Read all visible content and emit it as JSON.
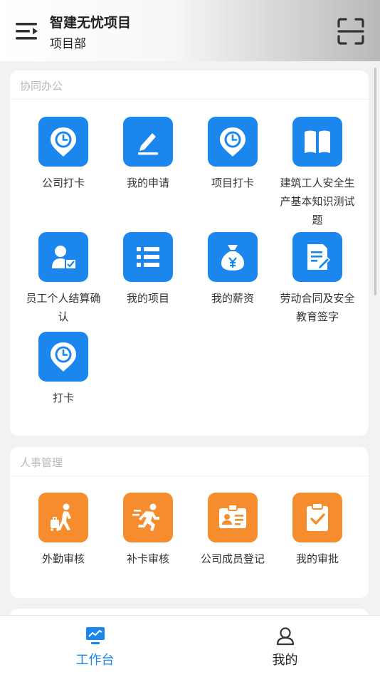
{
  "header": {
    "title": "智建无忧项目",
    "subtitle": "项目部",
    "menu_icon": "menu-indent-icon",
    "scan_icon": "scan-icon"
  },
  "sections": [
    {
      "title": "协同办公",
      "color": "#1a86ee",
      "items": [
        {
          "label": "公司打卡",
          "icon": "clock-pin-icon"
        },
        {
          "label": "我的申请",
          "icon": "edit-pen-icon"
        },
        {
          "label": "项目打卡",
          "icon": "clock-pin-icon"
        },
        {
          "label": "建筑工人安全生产基本知识测试题",
          "icon": "book-icon"
        },
        {
          "label": "员工个人结算确认",
          "icon": "user-check-icon"
        },
        {
          "label": "我的项目",
          "icon": "list-icon"
        },
        {
          "label": "我的薪资",
          "icon": "money-bag-icon"
        },
        {
          "label": "劳动合同及安全教育签字",
          "icon": "document-sign-icon"
        },
        {
          "label": "打卡",
          "icon": "clock-pin-icon"
        }
      ]
    },
    {
      "title": "人事管理",
      "color": "#f58d2e",
      "items": [
        {
          "label": "外勤审核",
          "icon": "walking-luggage-icon"
        },
        {
          "label": "补卡审核",
          "icon": "running-icon"
        },
        {
          "label": "公司成员登记",
          "icon": "id-card-icon"
        },
        {
          "label": "我的审批",
          "icon": "clipboard-check-icon"
        }
      ]
    }
  ],
  "tabbar": {
    "items": [
      {
        "label": "工作台",
        "icon": "monitor-chart-icon",
        "active": true,
        "color": "#1a86ee"
      },
      {
        "label": "我的",
        "icon": "user-icon",
        "active": false,
        "color": "#222222"
      }
    ]
  }
}
